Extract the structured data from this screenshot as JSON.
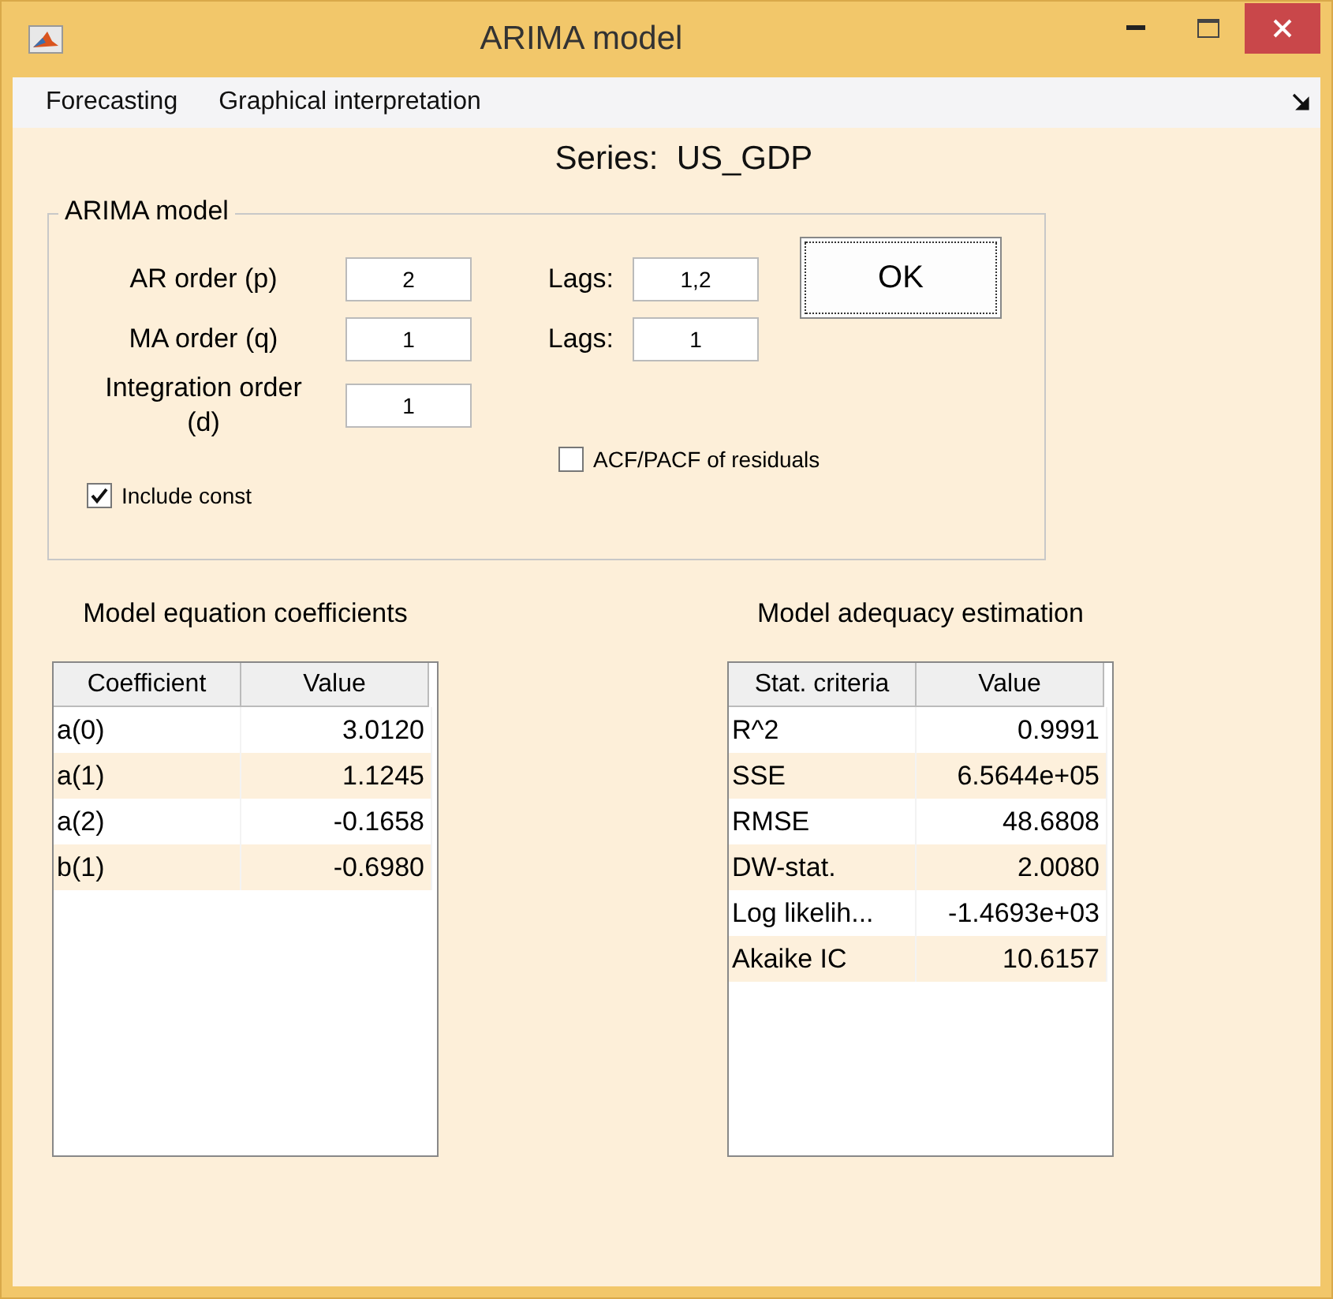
{
  "window": {
    "title": "ARIMA model"
  },
  "menu": [
    "Forecasting",
    "Graphical interpretation"
  ],
  "series_title": "Series:  US_GDP",
  "group": {
    "title": "ARIMA model",
    "fields": [
      {
        "label": "AR order (p)",
        "value": "2",
        "lags_label": "Lags:",
        "lags_value": "1,2"
      },
      {
        "label": "MA order (q)",
        "value": "1",
        "lags_label": "Lags:",
        "lags_value": "1"
      },
      {
        "label": "Integration order (d)",
        "value": "1"
      }
    ],
    "ok_button": "OK",
    "checkboxes": [
      {
        "label": "ACF/PACF of residuals",
        "checked": false
      },
      {
        "label": "Include const",
        "checked": true
      }
    ]
  },
  "tables": [
    {
      "title": "Model equation coefficients",
      "columns": [
        "Coefficient",
        "Value"
      ],
      "rows": [
        [
          "a(0)",
          "3.0120"
        ],
        [
          "a(1)",
          "1.1245"
        ],
        [
          "a(2)",
          "-0.1658"
        ],
        [
          "b(1)",
          "-0.6980"
        ]
      ]
    },
    {
      "title": "Model adequacy estimation",
      "columns": [
        "Stat. criteria",
        "Value"
      ],
      "rows": [
        [
          "R^2",
          "0.9991"
        ],
        [
          "SSE",
          "6.5644e+05"
        ],
        [
          "RMSE",
          "48.6808"
        ],
        [
          "DW-stat.",
          "2.0080"
        ],
        [
          "Log likelih...",
          "-1.4693e+03"
        ],
        [
          "Akaike IC",
          "10.6157"
        ]
      ]
    }
  ]
}
